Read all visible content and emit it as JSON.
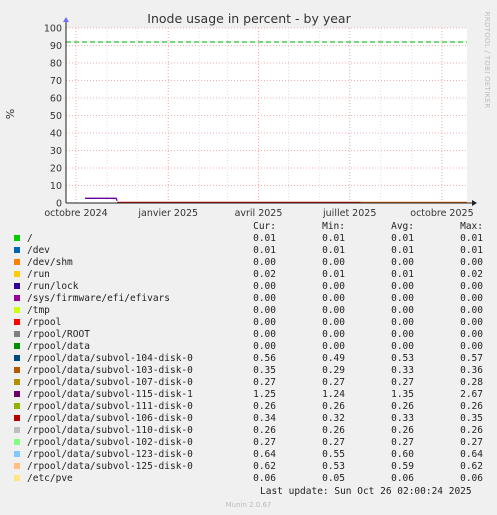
{
  "chart_data": {
    "type": "line",
    "title": "Inode usage in percent - by year",
    "ylabel": "%",
    "ylim": [
      0,
      100
    ],
    "yticks": [
      "0",
      "10",
      "20",
      "30",
      "40",
      "50",
      "60",
      "70",
      "80",
      "90",
      "100"
    ],
    "x_tick_labels": [
      "octobre 2024",
      "janvier 2025",
      "avril 2025",
      "juillet 2025",
      "octobre 2025"
    ],
    "grid": true,
    "side_label": "RRDTOOL / TOBI OETIKER",
    "warning_level": 92,
    "warning_color": "#00aa00",
    "series_highlight": {
      "name": "/rpool/data/subvol-115-disk-1",
      "color": "#660099",
      "x": [
        "2024-10-10",
        "2024-11-10",
        "2024-11-11"
      ],
      "y": [
        2.67,
        2.67,
        1.25
      ]
    },
    "series_low": {
      "name": "/rpool/data/subvol-106-disk-0",
      "color": "#cc0000",
      "x": [
        "2024-11-11",
        "2025-07-12"
      ],
      "y": [
        0.34,
        0.34
      ]
    },
    "series_tail": {
      "name": "/rpool/data/subvol-103-disk-0",
      "color": "#d95f00",
      "x": [
        "2025-07-12",
        "2025-10-26"
      ],
      "y": [
        0.35,
        0.35
      ]
    }
  },
  "legend": {
    "headers": {
      "cur": "Cur:",
      "min": "Min:",
      "avg": "Avg:",
      "max": "Max:"
    },
    "rows": [
      {
        "name": "/",
        "color": "#00cc00",
        "cur": "0.01",
        "min": "0.01",
        "avg": "0.01",
        "max": "0.01"
      },
      {
        "name": "/dev",
        "color": "#0066b3",
        "cur": "0.01",
        "min": "0.01",
        "avg": "0.01",
        "max": "0.01"
      },
      {
        "name": "/dev/shm",
        "color": "#ff8000",
        "cur": "0.00",
        "min": "0.00",
        "avg": "0.00",
        "max": "0.00"
      },
      {
        "name": "/run",
        "color": "#ffcc00",
        "cur": "0.02",
        "min": "0.01",
        "avg": "0.01",
        "max": "0.02"
      },
      {
        "name": "/run/lock",
        "color": "#330099",
        "cur": "0.00",
        "min": "0.00",
        "avg": "0.00",
        "max": "0.00"
      },
      {
        "name": "/sys/firmware/efi/efivars",
        "color": "#990099",
        "cur": "0.00",
        "min": "0.00",
        "avg": "0.00",
        "max": "0.00"
      },
      {
        "name": "/tmp",
        "color": "#ccff00",
        "cur": "0.00",
        "min": "0.00",
        "avg": "0.00",
        "max": "0.00"
      },
      {
        "name": "/rpool",
        "color": "#ff0000",
        "cur": "0.00",
        "min": "0.00",
        "avg": "0.00",
        "max": "0.00"
      },
      {
        "name": "/rpool/ROOT",
        "color": "#808080",
        "cur": "0.00",
        "min": "0.00",
        "avg": "0.00",
        "max": "0.00"
      },
      {
        "name": "/rpool/data",
        "color": "#008f00",
        "cur": "0.00",
        "min": "0.00",
        "avg": "0.00",
        "max": "0.00"
      },
      {
        "name": "/rpool/data/subvol-104-disk-0",
        "color": "#00487d",
        "cur": "0.56",
        "min": "0.49",
        "avg": "0.53",
        "max": "0.57"
      },
      {
        "name": "/rpool/data/subvol-103-disk-0",
        "color": "#b35a00",
        "cur": "0.35",
        "min": "0.29",
        "avg": "0.33",
        "max": "0.36"
      },
      {
        "name": "/rpool/data/subvol-107-disk-0",
        "color": "#b38f00",
        "cur": "0.27",
        "min": "0.27",
        "avg": "0.27",
        "max": "0.28"
      },
      {
        "name": "/rpool/data/subvol-115-disk-1",
        "color": "#6b006b",
        "cur": "1.25",
        "min": "1.24",
        "avg": "1.35",
        "max": "2.67"
      },
      {
        "name": "/rpool/data/subvol-111-disk-0",
        "color": "#8fb300",
        "cur": "0.26",
        "min": "0.26",
        "avg": "0.26",
        "max": "0.26"
      },
      {
        "name": "/rpool/data/subvol-106-disk-0",
        "color": "#b30000",
        "cur": "0.34",
        "min": "0.32",
        "avg": "0.33",
        "max": "0.35"
      },
      {
        "name": "/rpool/data/subvol-110-disk-0",
        "color": "#bebebe",
        "cur": "0.26",
        "min": "0.26",
        "avg": "0.26",
        "max": "0.26"
      },
      {
        "name": "/rpool/data/subvol-102-disk-0",
        "color": "#80ff80",
        "cur": "0.27",
        "min": "0.27",
        "avg": "0.27",
        "max": "0.27"
      },
      {
        "name": "/rpool/data/subvol-123-disk-0",
        "color": "#80c9ff",
        "cur": "0.64",
        "min": "0.55",
        "avg": "0.60",
        "max": "0.64"
      },
      {
        "name": "/rpool/data/subvol-125-disk-0",
        "color": "#ffc080",
        "cur": "0.62",
        "min": "0.53",
        "avg": "0.59",
        "max": "0.62"
      },
      {
        "name": "/etc/pve",
        "color": "#ffe680",
        "cur": "0.06",
        "min": "0.05",
        "avg": "0.06",
        "max": "0.06"
      }
    ]
  },
  "footer": {
    "last_update": "Last update: Sun Oct 26 02:00:24 2025",
    "version": "Munin 2.0.67"
  }
}
